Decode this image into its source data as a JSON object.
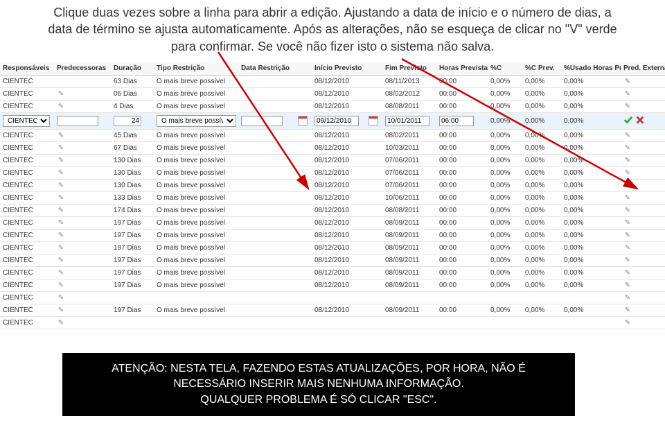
{
  "instructions": "Clique duas vezes sobre a linha para abrir a edição. Ajustando a data de início e o número de dias, a data de término se ajusta automaticamente. Após as alterações, não se esqueça de clicar no \"V\" verde para confirmar. Se você não fizer isto o sistema não salva.",
  "headers": [
    "Responsáveis",
    "Predecessoras",
    "Duração",
    "Tipo Restrição",
    "Data Restrição",
    "",
    "Início Previsto",
    "",
    "Fim Previsto",
    "Horas Previstas",
    "%C",
    "%C Prev.",
    "%Usado Horas Prev.",
    "Pred. Externas"
  ],
  "rows": [
    {
      "resp": "CIENTEC",
      "pred": "",
      "dur": "63 Dias",
      "tipo": "O mais breve possível",
      "dr": "",
      "ini": "08/12/2010",
      "fim": "08/11/2013",
      "hp": "00:00",
      "c": "0,00%",
      "cp": "0,00%",
      "up": "0,00%",
      "editing": false,
      "pencil": false
    },
    {
      "resp": "CIENTEC",
      "pred": "",
      "dur": "06 Dias",
      "tipo": "O mais breve possível",
      "dr": "",
      "ini": "08/12/2010",
      "fim": "08/02/2012",
      "hp": "00:00",
      "c": "0,00%",
      "cp": "0,00%",
      "up": "0,00%",
      "editing": false,
      "pencil": true
    },
    {
      "resp": "CIENTEC",
      "pred": "",
      "dur": "4 Dias",
      "tipo": "O mais breve possível",
      "dr": "",
      "ini": "08/12/2010",
      "fim": "08/08/2011",
      "hp": "00:00",
      "c": "0,00%",
      "cp": "0,00%",
      "up": "0,00%",
      "editing": false,
      "pencil": true
    },
    {
      "resp": "CIENTEC",
      "pred": "",
      "dur": "24",
      "tipo": "O mais breve possível",
      "dr": "",
      "ini": "09/12/2010",
      "fim": "10/01/2011",
      "hp": "06:00",
      "c": "0,00%",
      "cp": "0,00%",
      "up": "0,00%",
      "editing": true,
      "pencil": false
    },
    {
      "resp": "CIENTEC",
      "pred": "",
      "dur": "45 Dias",
      "tipo": "O mais breve possível",
      "dr": "",
      "ini": "08/12/2010",
      "fim": "08/02/2011",
      "hp": "00:00",
      "c": "0,00%",
      "cp": "0,00%",
      "up": "0,00%",
      "editing": false,
      "pencil": true
    },
    {
      "resp": "CIENTEC",
      "pred": "",
      "dur": "67 Dias",
      "tipo": "O mais breve possível",
      "dr": "",
      "ini": "08/12/2010",
      "fim": "10/03/2011",
      "hp": "00:00",
      "c": "0,00%",
      "cp": "0,00%",
      "up": "0,00%",
      "editing": false,
      "pencil": true
    },
    {
      "resp": "CIENTEC",
      "pred": "",
      "dur": "130 Dias",
      "tipo": "O mais breve possível",
      "dr": "",
      "ini": "08/12/2010",
      "fim": "07/06/2011",
      "hp": "00:00",
      "c": "0,00%",
      "cp": "0,00%",
      "up": "0,00%",
      "editing": false,
      "pencil": true
    },
    {
      "resp": "CIENTEC",
      "pred": "",
      "dur": "130 Dias",
      "tipo": "O mais breve possível",
      "dr": "",
      "ini": "08/12/2010",
      "fim": "07/06/2011",
      "hp": "00:00",
      "c": "0,00%",
      "cp": "0,00%",
      "up": "0,00%",
      "editing": false,
      "pencil": true
    },
    {
      "resp": "CIENTEC",
      "pred": "",
      "dur": "130 Dias",
      "tipo": "O mais breve possível",
      "dr": "",
      "ini": "08/12/2010",
      "fim": "07/06/2011",
      "hp": "00:00",
      "c": "0,00%",
      "cp": "0,00%",
      "up": "0,00%",
      "editing": false,
      "pencil": true
    },
    {
      "resp": "CIENTEC",
      "pred": "",
      "dur": "133 Dias",
      "tipo": "O mais breve possível",
      "dr": "",
      "ini": "08/12/2010",
      "fim": "10/06/2011",
      "hp": "00:00",
      "c": "0,00%",
      "cp": "0,00%",
      "up": "0,00%",
      "editing": false,
      "pencil": true
    },
    {
      "resp": "CIENTEC",
      "pred": "",
      "dur": "174 Dias",
      "tipo": "O mais breve possível",
      "dr": "",
      "ini": "08/12/2010",
      "fim": "08/08/2011",
      "hp": "00:00",
      "c": "0,00%",
      "cp": "0,00%",
      "up": "0,00%",
      "editing": false,
      "pencil": true
    },
    {
      "resp": "CIENTEC",
      "pred": "",
      "dur": "197 Dias",
      "tipo": "O mais breve possível",
      "dr": "",
      "ini": "08/12/2010",
      "fim": "08/09/2011",
      "hp": "00:00",
      "c": "0,00%",
      "cp": "0,00%",
      "up": "0,00%",
      "editing": false,
      "pencil": true
    },
    {
      "resp": "CIENTEC",
      "pred": "",
      "dur": "197 Dias",
      "tipo": "O mais breve possível",
      "dr": "",
      "ini": "08/12/2010",
      "fim": "08/09/2011",
      "hp": "00:00",
      "c": "0,00%",
      "cp": "0,00%",
      "up": "0,00%",
      "editing": false,
      "pencil": true
    },
    {
      "resp": "CIENTEC",
      "pred": "",
      "dur": "197 Dias",
      "tipo": "O mais breve possível",
      "dr": "",
      "ini": "08/12/2010",
      "fim": "08/09/2011",
      "hp": "00:00",
      "c": "0,00%",
      "cp": "0,00%",
      "up": "0,00%",
      "editing": false,
      "pencil": true
    },
    {
      "resp": "CIENTEC",
      "pred": "",
      "dur": "197 Dias",
      "tipo": "O mais breve possível",
      "dr": "",
      "ini": "08/12/2010",
      "fim": "08/09/2011",
      "hp": "00:00",
      "c": "0,00%",
      "cp": "0,00%",
      "up": "0,00%",
      "editing": false,
      "pencil": true
    },
    {
      "resp": "CIENTEC",
      "pred": "",
      "dur": "197 Dias",
      "tipo": "O mais breve possível",
      "dr": "",
      "ini": "08/12/2010",
      "fim": "08/09/2011",
      "hp": "00:00",
      "c": "0,00%",
      "cp": "0,00%",
      "up": "0,00%",
      "editing": false,
      "pencil": true
    },
    {
      "resp": "CIENTEC",
      "pred": "",
      "dur": "197 Dias",
      "tipo": "O mais breve possível",
      "dr": "",
      "ini": "08/12/2010",
      "fim": "08/09/2011",
      "hp": "00:00",
      "c": "0,00%",
      "cp": "0,00%",
      "up": "0,00%",
      "editing": false,
      "pencil": true
    },
    {
      "resp": "CIENTEC",
      "pred": "",
      "dur": "",
      "tipo": "",
      "dr": "",
      "ini": "",
      "fim": "",
      "hp": "",
      "c": "",
      "cp": "",
      "up": "",
      "editing": false,
      "pencil": true
    },
    {
      "resp": "CIENTEC",
      "pred": "",
      "dur": "197 Dias",
      "tipo": "O mais breve possível",
      "dr": "",
      "ini": "08/12/2010",
      "fim": "08/09/2011",
      "hp": "00:00",
      "c": "0,00%",
      "cp": "0,00%",
      "up": "0,00%",
      "editing": false,
      "pencil": true
    },
    {
      "resp": "CIENTEC",
      "pred": "",
      "dur": "",
      "tipo": "",
      "dr": "",
      "ini": "",
      "fim": "",
      "hp": "",
      "c": "",
      "cp": "",
      "up": "",
      "editing": false,
      "pencil": true
    }
  ],
  "footer": {
    "line1": "ATENÇÃO: NESTA TELA, FAZENDO ESTAS ATUALIZAÇÕES, POR HORA, NÃO É",
    "line2": "NECESSÁRIO INSERIR MAIS NENHUMA INFORMAÇÃO.",
    "line3": "QUALQUER PROBLEMA É SÓ CLICAR \"ESC\"."
  }
}
